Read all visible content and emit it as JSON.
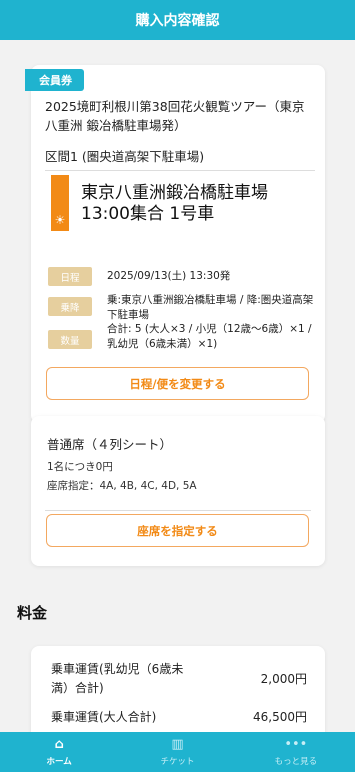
{
  "header": {
    "title": "購入内容確認"
  },
  "ticket_card": {
    "badge": "会員券",
    "tour_title": "2025境町利根川第38回花火観覧ツアー（東京八重洲 鍛冶橋駐車場発）",
    "section": "区間1 (圏央道高架下駐車場)",
    "stop_title": "東京八重洲鍛冶橋駐車場\n13:00集合 1号車",
    "rows": [
      {
        "label": "日程",
        "text": "2025/09/13(土) 13:30発"
      },
      {
        "label": "乗降",
        "text": "乗:東京八重洲鍛冶橋駐車場 / 降:圏央道高架下駐車場"
      },
      {
        "label": "数量",
        "text": "合計: 5 (大人×3 / 小児（12歳〜6歳）×1 / 乳幼児（6歳未満）×1)"
      }
    ],
    "change_button": "日程/便を変更する"
  },
  "seat_card": {
    "title": "普通席（４列シート）",
    "per_person": "1名につき0円",
    "seat_assign": "座席指定：4A, 4B, 4C, 4D, 5A",
    "select_button": "座席を指定する"
  },
  "fees": {
    "heading": "料金",
    "rows": [
      {
        "label": "乗車運賃(乳幼児（6歳未満）合計)",
        "value": "2,000円"
      },
      {
        "label": "乗車運賃(大人合計)",
        "value": "46,500円"
      }
    ]
  },
  "tabbar": {
    "items": [
      {
        "label": "ホーム",
        "icon": "home-icon"
      },
      {
        "label": "チケット",
        "icon": "ticket-icon"
      },
      {
        "label": "もっと見る",
        "icon": "more-icon"
      }
    ]
  },
  "colors": {
    "accent": "#1fb3cf",
    "orange": "#f28a16",
    "label_bg": "#e6cf9e"
  }
}
